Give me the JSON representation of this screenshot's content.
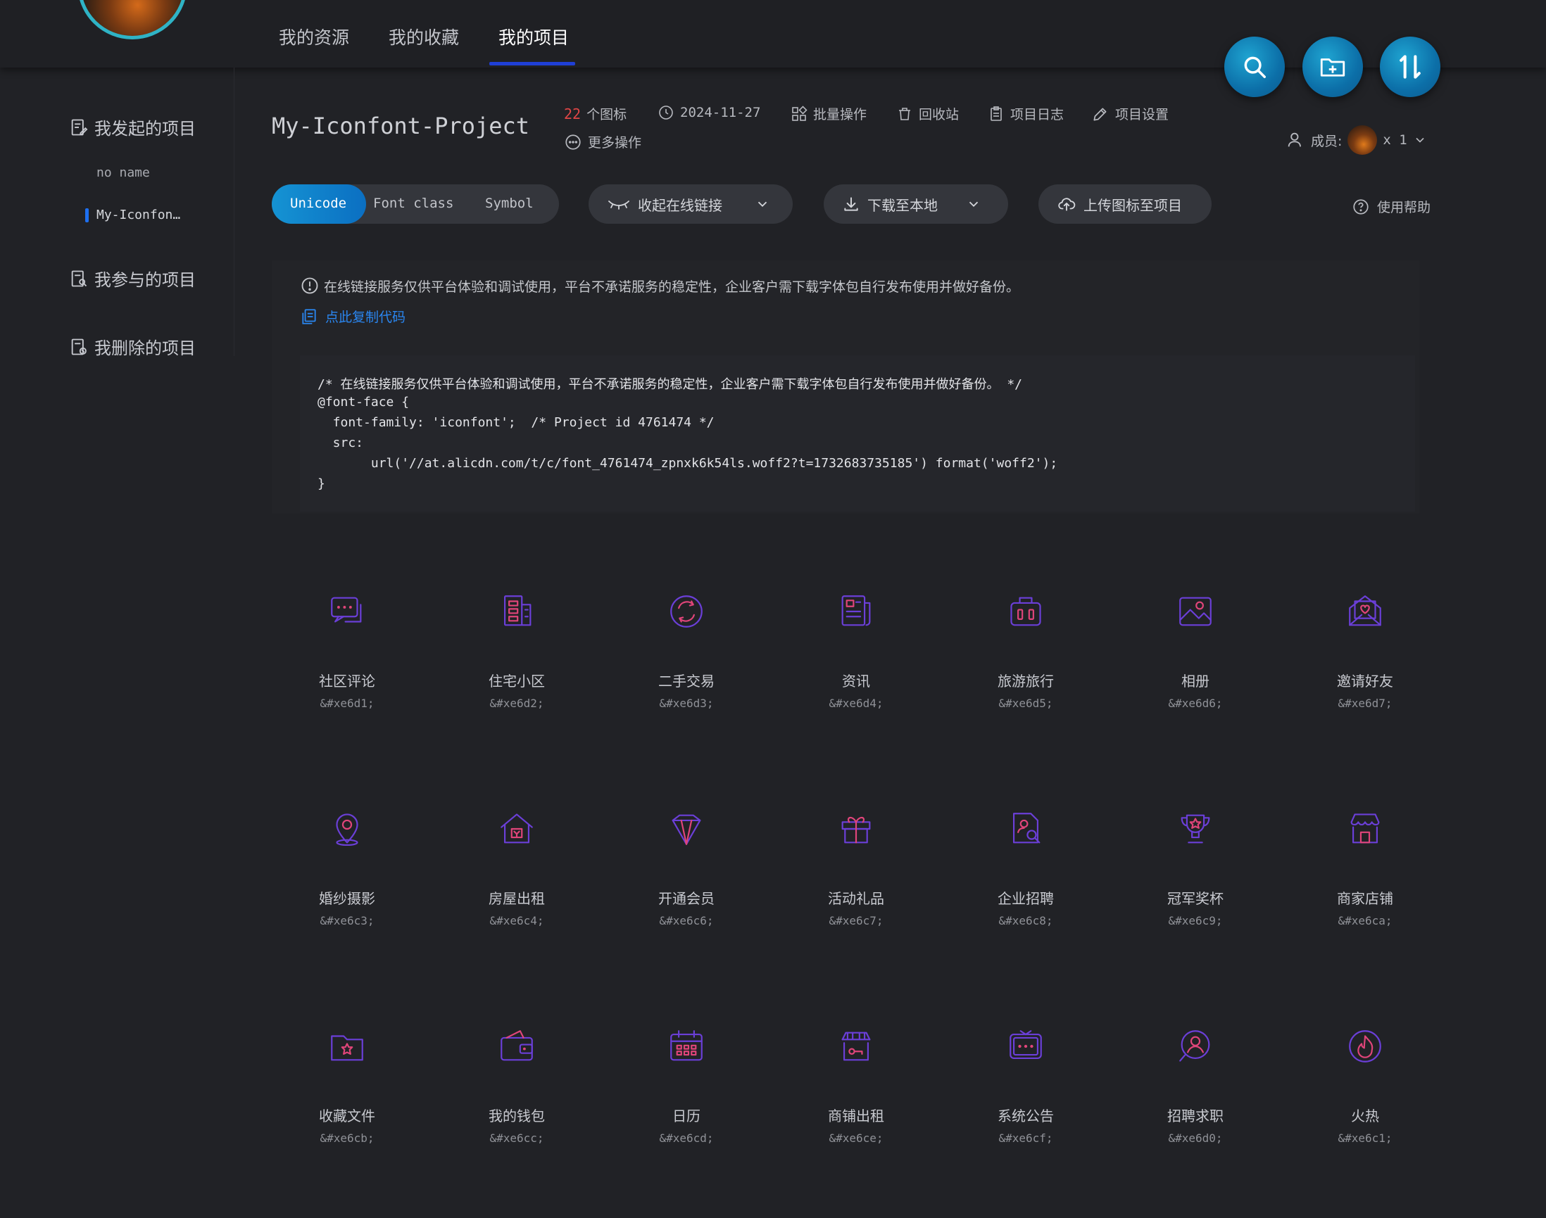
{
  "header": {
    "tabs": [
      {
        "label": "我的资源"
      },
      {
        "label": "我的收藏"
      },
      {
        "label": "我的项目"
      }
    ],
    "active_tab": "我的项目"
  },
  "sidebar": {
    "sections": [
      {
        "label": "我发起的项目"
      },
      {
        "label": "我参与的项目"
      },
      {
        "label": "我删除的项目"
      }
    ],
    "projects": [
      {
        "label": "no name"
      },
      {
        "label": "My-Iconfon…"
      }
    ]
  },
  "project": {
    "title": "My-Iconfont-Project",
    "icon_count": "22",
    "icon_count_unit": "个图标",
    "date": "2024-11-27",
    "actions": [
      "批量操作",
      "回收站",
      "项目日志",
      "项目设置"
    ],
    "more": "更多操作",
    "members_label": "成员:",
    "members_count": "x 1"
  },
  "toolbar": {
    "segments": [
      "Unicode",
      "Font class",
      "Symbol"
    ],
    "active_segment": "Unicode",
    "collapse_link": "收起在线链接",
    "download": "下载至本地",
    "upload": "上传图标至项目",
    "help": "使用帮助"
  },
  "notice": {
    "text": "在线链接服务仅供平台体验和调试使用，平台不承诺服务的稳定性，企业客户需下载字体包自行发布使用并做好备份。",
    "copy": "点此复制代码"
  },
  "code": [
    "/* 在线链接服务仅供平台体验和调试使用，平台不承诺服务的稳定性，企业客户需下载字体包自行发布使用并做好备份。 */",
    "@font-face {",
    "  font-family: 'iconfont';  /* Project id 4761474 */",
    "  src:",
    "       url('//at.alicdn.com/t/c/font_4761474_zpnxk6k54ls.woff2?t=1732683735185') format('woff2');",
    "}"
  ],
  "icons": [
    {
      "name": "社区评论",
      "code": "&#xe6d1;",
      "icon": "chat-icon"
    },
    {
      "name": "住宅小区",
      "code": "&#xe6d2;",
      "icon": "building-icon"
    },
    {
      "name": "二手交易",
      "code": "&#xe6d3;",
      "icon": "exchange-icon"
    },
    {
      "name": "资讯",
      "code": "&#xe6d4;",
      "icon": "news-icon"
    },
    {
      "name": "旅游旅行",
      "code": "&#xe6d5;",
      "icon": "luggage-icon"
    },
    {
      "name": "相册",
      "code": "&#xe6d6;",
      "icon": "photo-icon"
    },
    {
      "name": "邀请好友",
      "code": "&#xe6d7;",
      "icon": "invite-icon"
    },
    {
      "name": "婚纱摄影",
      "code": "&#xe6c3;",
      "icon": "location-icon"
    },
    {
      "name": "房屋出租",
      "code": "&#xe6c4;",
      "icon": "house-icon"
    },
    {
      "name": "开通会员",
      "code": "&#xe6c6;",
      "icon": "diamond-icon"
    },
    {
      "name": "活动礼品",
      "code": "&#xe6c7;",
      "icon": "gift-icon"
    },
    {
      "name": "企业招聘",
      "code": "&#xe6c8;",
      "icon": "recruit-icon"
    },
    {
      "name": "冠军奖杯",
      "code": "&#xe6c9;",
      "icon": "trophy-icon"
    },
    {
      "name": "商家店铺",
      "code": "&#xe6ca;",
      "icon": "shop-icon"
    },
    {
      "name": "收藏文件",
      "code": "&#xe6cb;",
      "icon": "folder-star-icon"
    },
    {
      "name": "我的钱包",
      "code": "&#xe6cc;",
      "icon": "wallet-icon"
    },
    {
      "name": "日历",
      "code": "&#xe6cd;",
      "icon": "calendar-icon"
    },
    {
      "name": "商铺出租",
      "code": "&#xe6ce;",
      "icon": "store-rent-icon"
    },
    {
      "name": "系统公告",
      "code": "&#xe6cf;",
      "icon": "notice-icon"
    },
    {
      "name": "招聘求职",
      "code": "&#xe6d0;",
      "icon": "job-search-icon"
    },
    {
      "name": "火热",
      "code": "&#xe6c1;",
      "icon": "fire-icon"
    }
  ],
  "colors": {
    "accent_blue": "#0b6fc2",
    "icon_purple": "#6b3fd8",
    "icon_pink": "#e0457a",
    "count_red": "#e04646",
    "link_blue": "#2a86f0"
  }
}
